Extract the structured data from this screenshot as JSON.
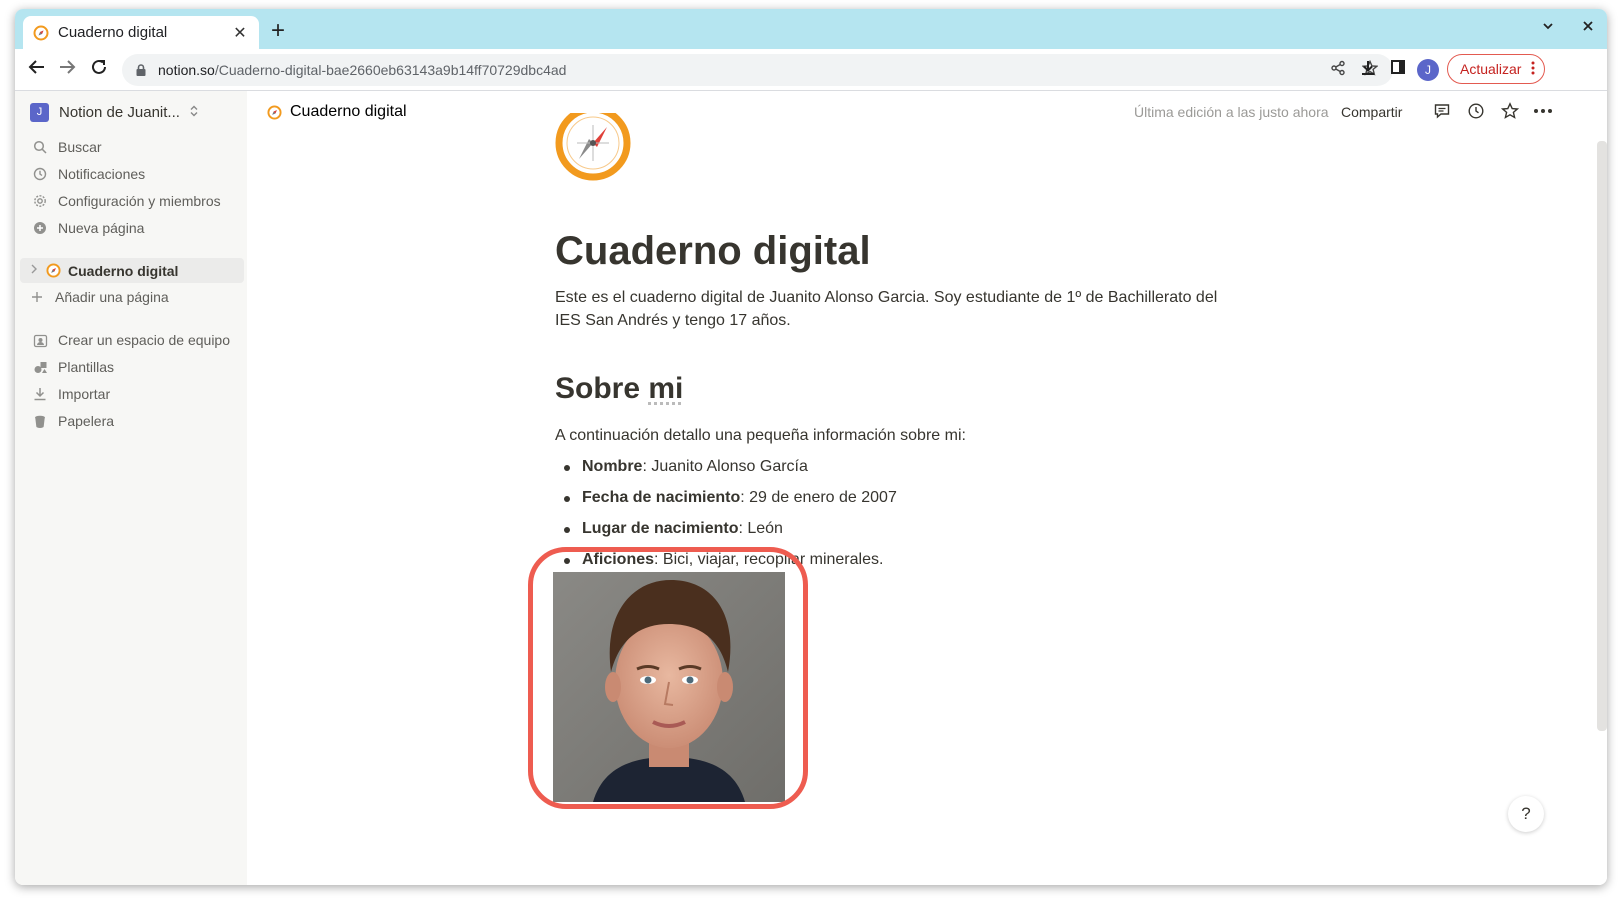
{
  "browser": {
    "tab_title": "Cuaderno digital",
    "tab_close": "✕",
    "new_tab": "+",
    "url_host": "notion.so",
    "url_path": "/Cuaderno-digital-bae2660eb63143a9b14ff70729dbc4ad",
    "profile_initial": "J",
    "update_label": "Actualizar"
  },
  "sidebar": {
    "workspace_initial": "J",
    "workspace_name": "Notion de Juanit...",
    "items": [
      {
        "label": "Buscar",
        "icon": "search-icon"
      },
      {
        "label": "Notificaciones",
        "icon": "clock-icon"
      },
      {
        "label": "Configuración y miembros",
        "icon": "gear-icon"
      },
      {
        "label": "Nueva página",
        "icon": "plus-circle-icon"
      }
    ],
    "page": "Cuaderno digital",
    "add_page": "Añadir una página",
    "bottom_items": [
      {
        "label": "Crear un espacio de equipo",
        "icon": "team-icon"
      },
      {
        "label": "Plantillas",
        "icon": "templates-icon"
      },
      {
        "label": "Importar",
        "icon": "import-icon"
      },
      {
        "label": "Papelera",
        "icon": "trash-icon"
      }
    ]
  },
  "topbar": {
    "breadcrumb": "Cuaderno digital",
    "edited": "Última edición a las justo ahora",
    "share": "Compartir"
  },
  "page": {
    "title": "Cuaderno digital",
    "intro": "Este es el cuaderno digital de Juanito Alonso Garcia. Soy estudiante de 1º de Bachillerato del IES San Andrés y tengo 17 años.",
    "section_title_a": "Sobre ",
    "section_title_b": "mi",
    "section_intro": "A continuación detallo una pequeña información sobre mi:",
    "bullets": [
      {
        "key": "Nombre",
        "value": ": Juanito Alonso García"
      },
      {
        "key": "Fecha de nacimiento",
        "value": ": 29 de enero de 2007"
      },
      {
        "key": "Lugar de nacimiento",
        "value": ": León"
      },
      {
        "key": "Aficiones",
        "value": ": Bici, viajar, recopilar minerales."
      }
    ]
  },
  "help": "?",
  "colors": {
    "highlight": "#ee5c50",
    "tabstrip": "#b5e5f0",
    "sidebar_bg": "#f7f7f5",
    "accent": "#5b66c9"
  }
}
